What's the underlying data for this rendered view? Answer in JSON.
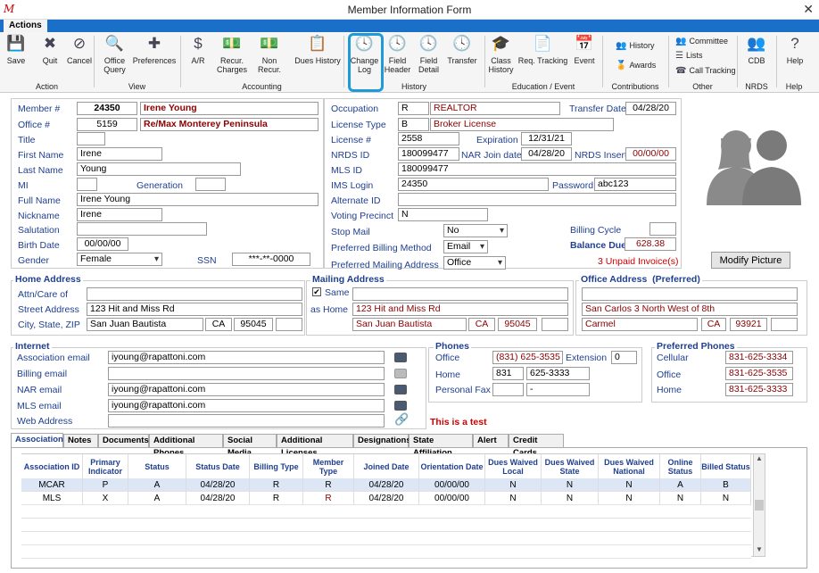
{
  "window": {
    "title": "Member Information Form",
    "close": "✕",
    "logo": "M"
  },
  "ribbon": {
    "tab": "Actions",
    "buttons": [
      {
        "label": "Save",
        "icon": "save-icon",
        "glyph": "💾"
      },
      {
        "label": "Quit",
        "icon": "quit-icon",
        "glyph": "✖"
      },
      {
        "label": "Cancel",
        "icon": "cancel-icon",
        "glyph": "⊘"
      },
      {
        "label": "Office Query",
        "icon": "office-query-icon",
        "glyph": "🔍"
      },
      {
        "label": "Preferences",
        "icon": "preferences-icon",
        "glyph": "✚"
      },
      {
        "label": "A/R",
        "icon": "ar-icon",
        "glyph": "$"
      },
      {
        "label": "Recur. Charges",
        "icon": "recur-charges-icon",
        "glyph": "💵"
      },
      {
        "label": "Non Recur.",
        "icon": "non-recur-icon",
        "glyph": "💵"
      },
      {
        "label": "Dues History",
        "icon": "dues-history-icon",
        "glyph": "📋"
      },
      {
        "label": "Change Log",
        "icon": "change-log-icon",
        "glyph": "🕓"
      },
      {
        "label": "Field Header",
        "icon": "field-header-icon",
        "glyph": "🕓"
      },
      {
        "label": "Field Detail",
        "icon": "field-detail-icon",
        "glyph": "🕓"
      },
      {
        "label": "Transfer",
        "icon": "transfer-icon",
        "glyph": "🕓"
      },
      {
        "label": "Class History",
        "icon": "class-history-icon",
        "glyph": "🎓"
      },
      {
        "label": "Req. Tracking",
        "icon": "req-tracking-icon",
        "glyph": "📄"
      },
      {
        "label": "Event",
        "icon": "event-icon",
        "glyph": "📅"
      },
      {
        "label": "CDB",
        "icon": "cdb-icon",
        "glyph": "👥"
      },
      {
        "label": "Help",
        "icon": "help-icon",
        "glyph": "?"
      }
    ],
    "small": {
      "history": "History",
      "awards": "Awards",
      "committee": "Committee",
      "lists": "Lists",
      "call_tracking": "Call Tracking"
    },
    "groups": {
      "action": "Action",
      "view": "View",
      "accounting": "Accounting",
      "history": "History",
      "education": "Education / Event",
      "contributions": "Contributions",
      "other": "Other",
      "nrds": "NRDS",
      "help": "Help"
    }
  },
  "member": {
    "member_no_label": "Member #",
    "member_no": "24350",
    "member_name": "Irene Young",
    "office_no_label": "Office #",
    "office_no": "5159",
    "office_name": "Re/Max Monterey Peninsula",
    "title_label": "Title",
    "title": "",
    "first_name_label": "First  Name",
    "first_name": "Irene",
    "last_name_label": "Last Name",
    "last_name": "Young",
    "mi_label": "MI",
    "mi": "",
    "generation_label": "Generation",
    "generation": "",
    "full_name_label": "Full Name",
    "full_name": "Irene Young",
    "nickname_label": "Nickname",
    "nickname": "Irene",
    "salutation_label": "Salutation",
    "salutation": "",
    "birth_date_label": "Birth Date",
    "birth_date": "00/00/00",
    "gender_label": "Gender",
    "gender": "Female",
    "ssn_label": "SSN",
    "ssn": "***-**-0000"
  },
  "occupation": {
    "occupation_label": "Occupation",
    "occupation_code": "R",
    "occupation": "REALTOR",
    "transfer_date_label": "Transfer Date",
    "transfer_date": "04/28/20",
    "license_type_label": "License Type",
    "license_type_code": "B",
    "license_type": "Broker License",
    "license_no_label": "License #",
    "license_no": "2558",
    "expiration_label": "Expiration",
    "expiration": "12/31/21",
    "nrds_id_label": "NRDS ID",
    "nrds_id": "180099477",
    "nar_join_label": "NAR Join date",
    "nar_join": "04/28/20",
    "nrds_insert_label": "NRDS Insert",
    "nrds_insert": "00/00/00",
    "mls_id_label": "MLS ID",
    "mls_id": "180099477",
    "ims_login_label": "IMS Login",
    "ims_login": "24350",
    "password_label": "Password",
    "password": "abc123",
    "alternate_id_label": "Alternate ID",
    "alternate_id": "",
    "voting_precinct_label": "Voting Precinct",
    "voting_precinct": "N",
    "stop_mail_label": "Stop Mail",
    "stop_mail": "No",
    "billing_cycle_label": "Billing Cycle",
    "billing_cycle": "",
    "pref_billing_label": "Preferred Billing Method",
    "pref_billing": "Email",
    "balance_due_label": "Balance Due",
    "balance_due": "628.38",
    "pref_mailing_label": "Preferred Mailing Address",
    "pref_mailing": "Office",
    "unpaid": "3 Unpaid Invoice(s)"
  },
  "modify_picture": "Modify Picture",
  "home": {
    "section": "Home Address",
    "attn_label": "Attn/Care of",
    "attn": "",
    "street_label": "Street Address",
    "street": "123 Hit and Miss Rd",
    "csz_label": "City, State, ZIP",
    "city": "San Juan Bautista",
    "state": "CA",
    "zip": "95045",
    "zip4": ""
  },
  "mailing": {
    "section": "Mailing Address",
    "same_label": "Same",
    "as_home_label": "as Home",
    "line1": "",
    "street": "123 Hit and Miss Rd",
    "city": "San Juan Bautista",
    "state": "CA",
    "zip": "95045",
    "zip4": "",
    "checkbox": "✔"
  },
  "office": {
    "section": "Office Address",
    "preferred": "(Preferred)",
    "line1": "",
    "street": "San Carlos 3 North West of 8th",
    "city": "Carmel",
    "state": "CA",
    "zip": "93921",
    "zip4": ""
  },
  "internet": {
    "section": "Internet",
    "assoc_label": "Association email",
    "assoc": "iyoung@rapattoni.com",
    "billing_label": "Billing email",
    "billing": "",
    "nar_label": "NAR email",
    "nar": "iyoung@rapattoni.com",
    "mls_label": "MLS email",
    "mls": "iyoung@rapattoni.com",
    "web_label": "Web Address",
    "web": "",
    "test_note": "This is a test"
  },
  "phones": {
    "section": "Phones",
    "office_label": "Office",
    "office": "(831) 625-3535",
    "ext_label": "Extension",
    "ext": "0",
    "home_label": "Home",
    "home_area": "831",
    "home": "625-3333",
    "fax_label": "Personal Fax",
    "fax_area": "",
    "fax": "-"
  },
  "pref_phones": {
    "section": "Preferred Phones",
    "cell_label": "Cellular",
    "cell": "831-625-3334",
    "office_label": "Office",
    "office": "831-625-3535",
    "home_label": "Home",
    "home": "831-625-3333"
  },
  "tabs": [
    "Associations",
    "Notes",
    "Documents",
    "Additional Phones",
    "Social Media",
    "Additional Licenses",
    "Designations",
    "State Affiliation",
    "Alert",
    "Credit Cards"
  ],
  "grid": {
    "headers": [
      "Association ID",
      "Primary Indicator",
      "Status",
      "Status Date",
      "Billing Type",
      "Member Type",
      "Joined Date",
      "Orientation Date",
      "Dues Waived Local",
      "Dues Waived State",
      "Dues Waived National",
      "Online Status",
      "Billed Status"
    ],
    "rows": [
      [
        "MCAR",
        "P",
        "A",
        "04/28/20",
        "R",
        "R",
        "04/28/20",
        "00/00/00",
        "N",
        "N",
        "N",
        "A",
        "B"
      ],
      [
        "MLS",
        "X",
        "A",
        "04/28/20",
        "R",
        "R",
        "04/28/20",
        "00/00/00",
        "N",
        "N",
        "N",
        "N",
        "N"
      ]
    ]
  }
}
